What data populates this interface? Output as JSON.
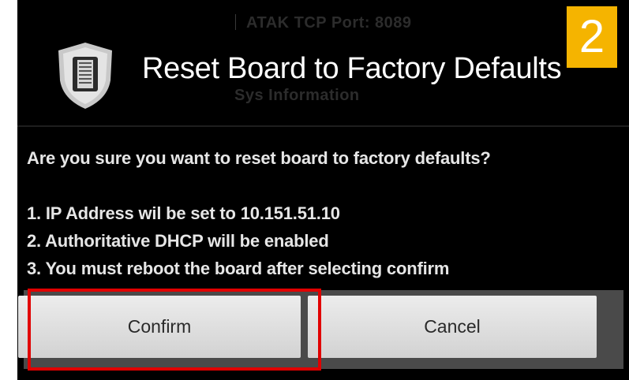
{
  "step_badge": "2",
  "background_ghost": {
    "line_1": "ATAK TCP Port: 8089",
    "line_2": "Sys Information"
  },
  "dialog": {
    "title": "Reset Board to Factory Defaults",
    "icon": "shield-icon",
    "message": "Are you sure you want to reset board to factory defaults?",
    "items": [
      "1. IP Address wil be set to 10.151.51.10",
      "2. Authoritative DHCP will be enabled",
      "3. You must reboot the board after selecting confirm"
    ],
    "confirm_label": "Confirm",
    "cancel_label": "Cancel"
  },
  "colors": {
    "dialog_bg": "#000000",
    "badge": "#f5b400",
    "highlight": "#e10000",
    "button": "#e0e0e0"
  }
}
